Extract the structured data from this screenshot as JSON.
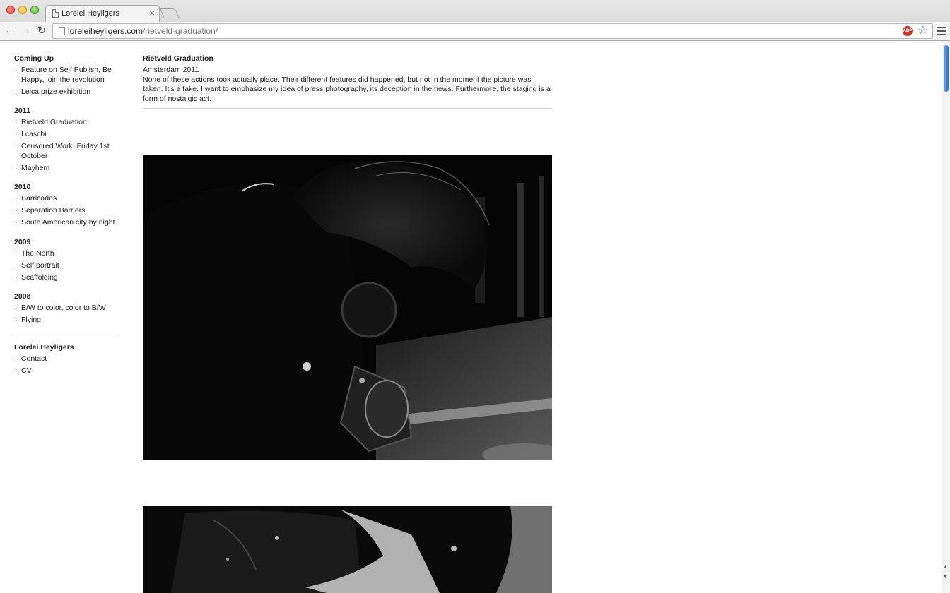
{
  "browser": {
    "tab_title": "Lorelei Heyligers",
    "tab_close": "×",
    "url_host": "loreleiheyligers.com",
    "url_path": "/rietveld-graduation/",
    "adblock_label": "ABP"
  },
  "sidebar": {
    "sections": [
      {
        "title": "Coming Up",
        "items": [
          "Feature on Self Publish, Be Happy, join the revolution",
          "Leica prize exhibition"
        ]
      },
      {
        "title": "2011",
        "items": [
          "Rietveld Graduation",
          "I caschi",
          "Censored Work, Friday 1st October",
          "Mayhem"
        ]
      },
      {
        "title": "2010",
        "items": [
          "Barricades",
          "Separation Barriers",
          "South American city by night"
        ]
      },
      {
        "title": "2009",
        "items": [
          "The North",
          "Self portrait",
          "Scaffolding"
        ]
      },
      {
        "title": "2008",
        "items": [
          "B/W to color, color to B/W",
          "Flying"
        ]
      }
    ],
    "about": {
      "title": "Lorelei Heyligers",
      "items": [
        "Contact",
        "CV"
      ]
    }
  },
  "post": {
    "title": "Rietveld Graduation",
    "place": "Amsterdam 2011",
    "description": "None of these actions took actually place. Their different features did happened, but not in the moment the picture was taken. It's a fake. I want to emphasize my idea of press photography, its deception in the news. Furthermore, the staging is a form of nostalgic act."
  },
  "colors": {
    "accent_scroll": "#3b7fe0",
    "text": "#222222",
    "divider": "#cfcfcf"
  }
}
